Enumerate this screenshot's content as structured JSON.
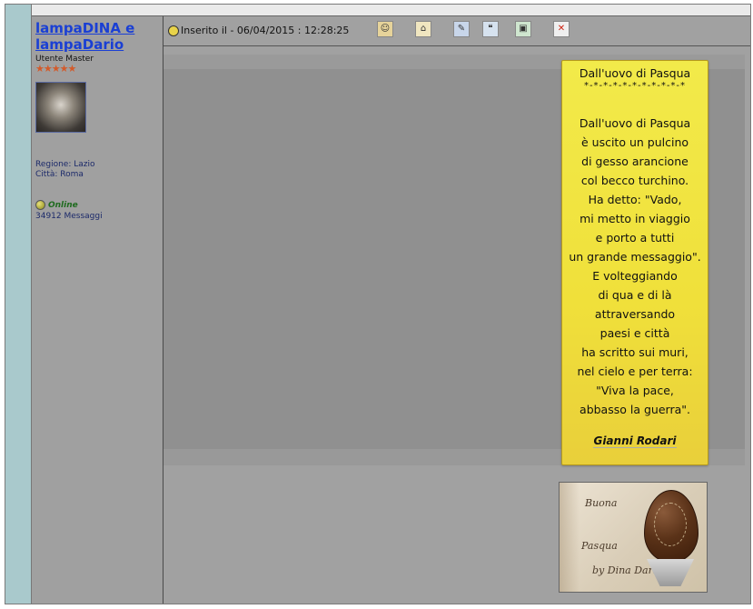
{
  "author": {
    "name": "lampaDINA e lampaDario",
    "role": "Utente Master",
    "stars": "★★★★★",
    "region_label": "Regione: Lazio",
    "city_label": "Città: Roma",
    "status": "Online",
    "posts": "34912 Messaggi"
  },
  "post": {
    "meta": "Inserito il - 06/04/2015 : 12:28:25",
    "toolbar_icons": [
      "profile-icon",
      "home-icon",
      "edit-icon",
      "reply-quote-icon",
      "save-icon",
      "delete-icon"
    ]
  },
  "poem": {
    "title": "Dall'uovo di Pasqua",
    "separator": "*-*-*-*-*-*-*-*-*-*-*",
    "lines": [
      "Dall'uovo di Pasqua",
      "è uscito un pulcino",
      "di gesso arancione",
      "col becco turchino.",
      "Ha detto: \"Vado,",
      "mi metto in viaggio",
      "e porto a tutti",
      "un grande messaggio\".",
      "E volteggiando",
      "di qua e di là",
      "attraversando",
      "paesi e città",
      "ha scritto sui muri,",
      "nel cielo e per terra:",
      "\"Viva la pace,",
      "abbasso la guerra\"."
    ],
    "signature": "Gianni Rodari"
  },
  "card": {
    "line1": "Buona",
    "line2": "Pasqua",
    "line3": "by Dina Dario"
  },
  "colors": {
    "page_bg": "#a1a1a1",
    "teal_bar": "#a9c9cc",
    "poem_bg": "#f0e03a",
    "link": "#1a3fd4"
  }
}
